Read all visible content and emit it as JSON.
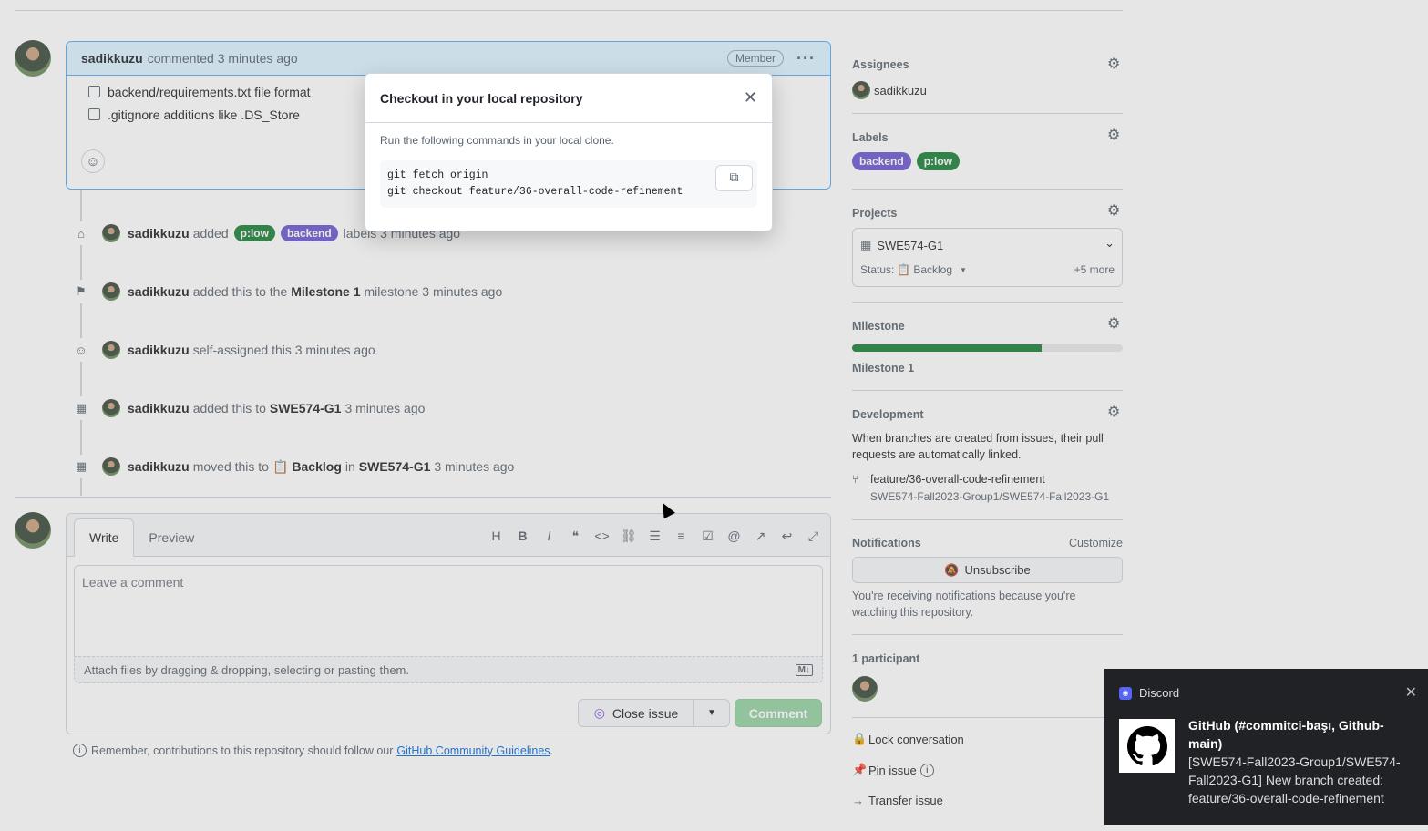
{
  "comment": {
    "author": "sadikkuzu",
    "meta": "commented 3 minutes ago",
    "badge": "Member",
    "tasks": [
      "backend/requirements.txt file format",
      ".gitignore additions like .DS_Store"
    ]
  },
  "timeline": [
    {
      "icon": "tag-icon",
      "user": "sadikkuzu",
      "pre": "added",
      "labels": [
        "p:low",
        "backend"
      ],
      "post": "labels 3 minutes ago"
    },
    {
      "icon": "milestone-icon",
      "user": "sadikkuzu",
      "pre": "added this to the",
      "bold": "Milestone 1",
      "post": "milestone 3 minutes ago"
    },
    {
      "icon": "person-icon",
      "user": "sadikkuzu",
      "pre": "self-assigned this 3 minutes ago"
    },
    {
      "icon": "table-icon",
      "user": "sadikkuzu",
      "pre": "added this to",
      "bold": "SWE574-G1",
      "post": "3 minutes ago"
    },
    {
      "icon": "table-icon",
      "user": "sadikkuzu",
      "pre": "moved this to",
      "bold": "Backlog",
      "mid": "in",
      "bold2": "SWE574-G1",
      "post": "3 minutes ago"
    }
  ],
  "editor": {
    "tab_write": "Write",
    "tab_preview": "Preview",
    "placeholder": "Leave a comment",
    "attach": "Attach files by dragging & dropping, selecting or pasting them.",
    "close_issue": "Close issue",
    "comment": "Comment",
    "guideline_pre": "Remember, contributions to this repository should follow our",
    "guideline_link": "GitHub Community Guidelines",
    "guideline_post": "."
  },
  "sidebar": {
    "assignees_h": "Assignees",
    "assignee": "sadikkuzu",
    "labels_h": "Labels",
    "labels": [
      "backend",
      "p:low"
    ],
    "projects_h": "Projects",
    "project_name": "SWE574-G1",
    "status_label": "Status:",
    "status_value": "Backlog",
    "more": "+5 more",
    "milestone_h": "Milestone",
    "milestone_progress": 0.7,
    "milestone_name": "Milestone 1",
    "development_h": "Development",
    "development_text": "When branches are created from issues, their pull requests are automatically linked.",
    "branch": "feature/36-overall-code-refinement",
    "repo": "SWE574-Fall2023-Group1/SWE574-Fall2023-G1",
    "notifications_h": "Notifications",
    "customize": "Customize",
    "unsubscribe": "Unsubscribe",
    "notif_text": "You're receiving notifications because you're watching this repository.",
    "participants_h": "1 participant",
    "lock": "Lock conversation",
    "pin": "Pin issue",
    "transfer": "Transfer issue"
  },
  "modal": {
    "title": "Checkout in your local repository",
    "desc": "Run the following commands in your local clone.",
    "cmd1": "git fetch origin",
    "cmd2": "git checkout feature/36-overall-code-refinement"
  },
  "toast": {
    "app": "Discord",
    "title": "GitHub (#commitci-başı, Github-main)",
    "body": "[SWE574-Fall2023-Group1/SWE574-Fall2023-G1] New branch created: feature/36-overall-code-refinement"
  },
  "colors": {
    "label_green": "#1a7f37",
    "label_purple": "#6e56cf",
    "accent": "#0969da",
    "discord_bg": "#202225"
  }
}
